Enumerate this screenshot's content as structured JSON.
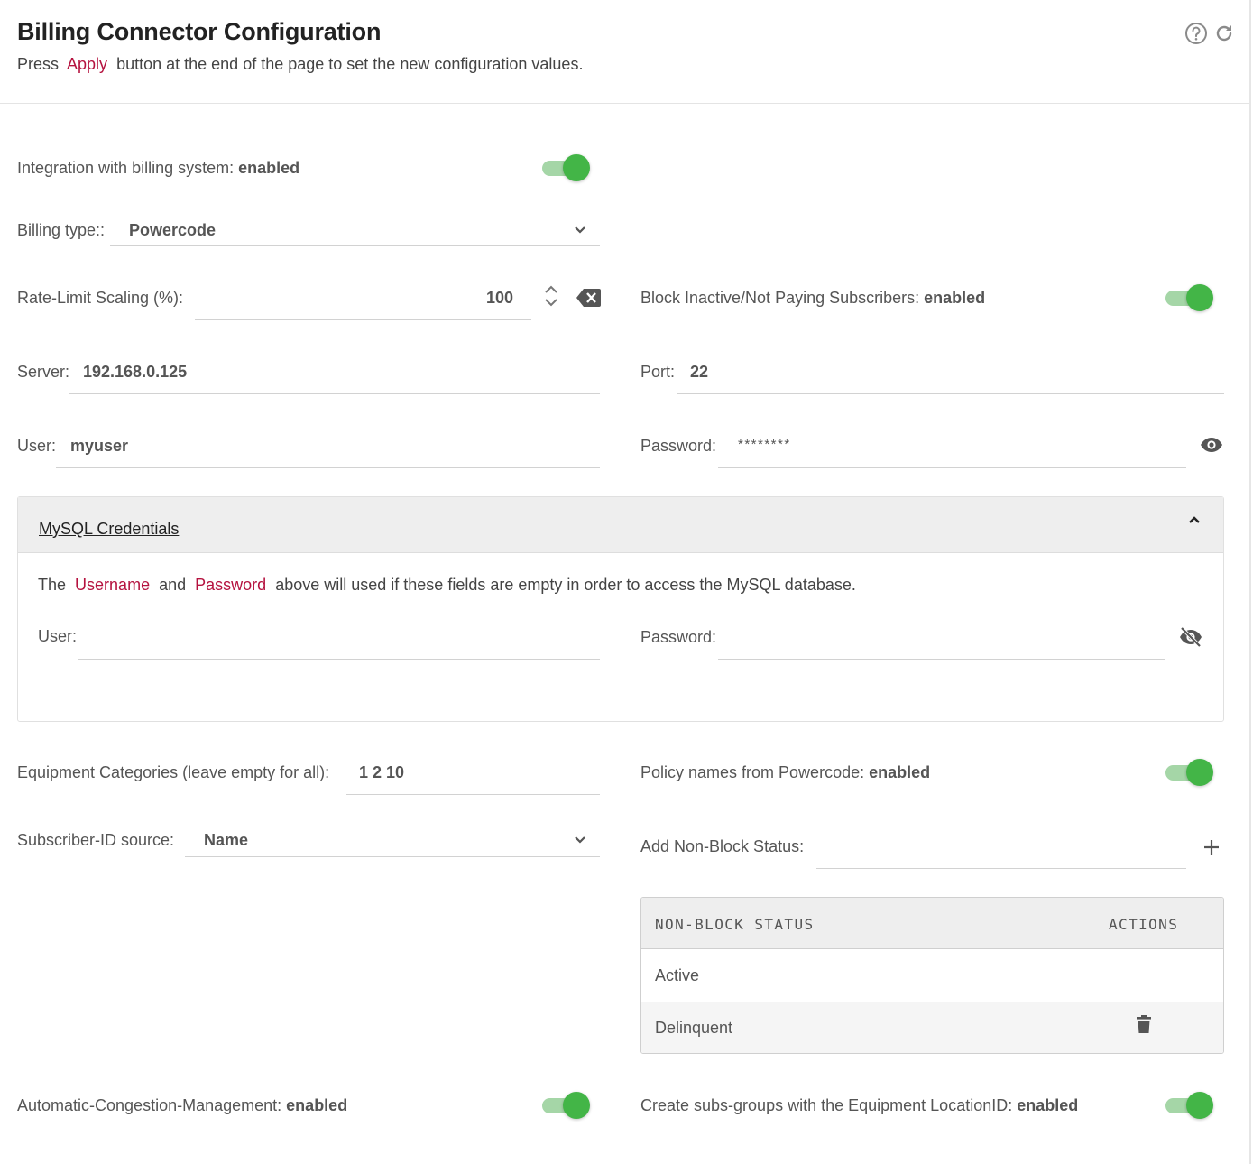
{
  "header": {
    "title": "Billing Connector Configuration",
    "sub_before": "Press",
    "sub_link": "Apply",
    "sub_after": "button at the end of the page to set the new configuration values."
  },
  "integration": {
    "label": "Integration with billing system:",
    "state": "enabled",
    "on": true
  },
  "billing_type": {
    "label": "Billing type::",
    "value": "Powercode"
  },
  "rate_limit": {
    "label": "Rate-Limit Scaling (%):",
    "value": "100"
  },
  "block_inactive": {
    "label": "Block Inactive/Not Paying Subscribers:",
    "state": "enabled",
    "on": true
  },
  "server": {
    "label": "Server:",
    "value": "192.168.0.125"
  },
  "port": {
    "label": "Port:",
    "value": "22"
  },
  "user": {
    "label": "User:",
    "value": "myuser"
  },
  "password": {
    "label": "Password:",
    "value": "********"
  },
  "mysql": {
    "title": "MySQL Credentials",
    "desc_1": "The",
    "desc_username": "Username",
    "desc_2": "and",
    "desc_password": "Password",
    "desc_3": "above will used if these fields are empty in order to access the MySQL database.",
    "user_label": "User:",
    "user_value": "",
    "password_label": "Password:",
    "password_value": ""
  },
  "equipment": {
    "label": "Equipment Categories (leave empty for all):",
    "value": "1 2 10"
  },
  "policy_names": {
    "label": "Policy names from Powercode:",
    "state": "enabled",
    "on": true
  },
  "subscriber_id": {
    "label": "Subscriber-ID source:",
    "value": "Name"
  },
  "non_block": {
    "label": "Add Non-Block Status:",
    "value": "",
    "table": {
      "headers": [
        "NON-BLOCK STATUS",
        "ACTIONS"
      ],
      "rows": [
        "Active",
        "Delinquent"
      ]
    }
  },
  "congestion": {
    "label": "Automatic-Congestion-Management:",
    "state": "enabled",
    "on": true
  },
  "subs_groups": {
    "label": "Create subs-groups with the Equipment LocationID:",
    "state": "enabled",
    "on": true
  },
  "colors": {
    "accent": "#b5123f",
    "toggle_on": "#43b547",
    "toggle_track": "#a5d6a7"
  }
}
